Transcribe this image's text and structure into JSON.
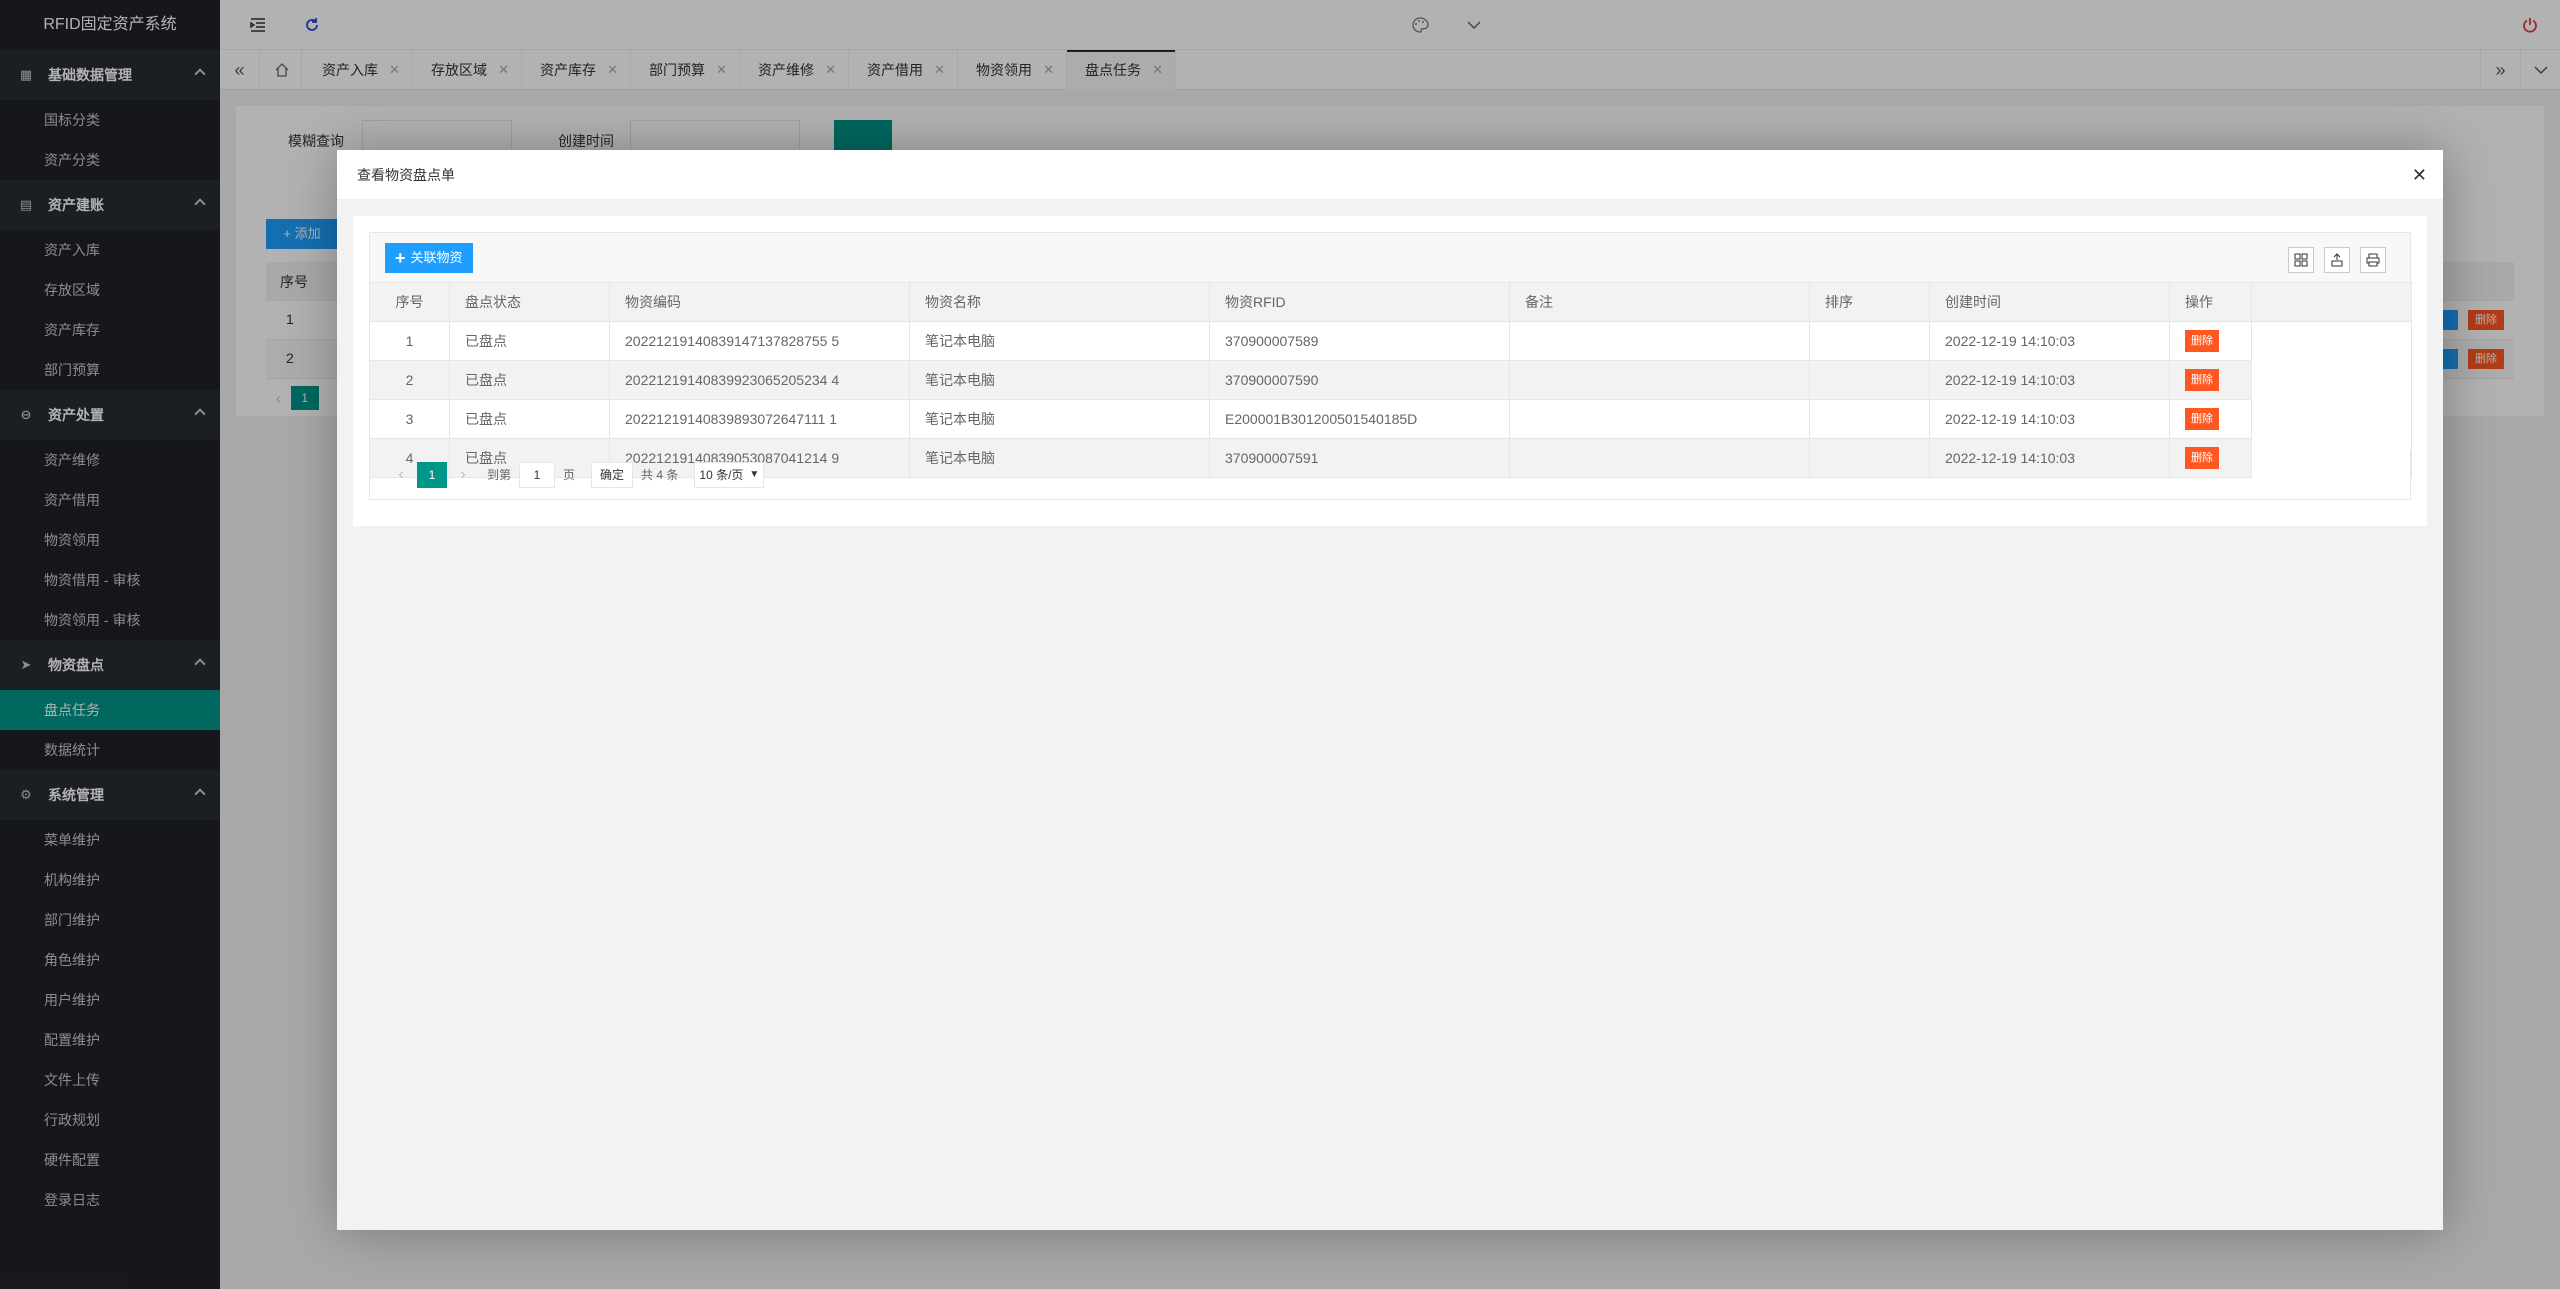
{
  "app": {
    "title": "RFID固定资产系统"
  },
  "sidebar": {
    "groups": [
      {
        "label": "基础数据管理",
        "icon": "database-icon",
        "items": [
          "国标分类",
          "资产分类"
        ]
      },
      {
        "label": "资产建账",
        "icon": "calendar-icon",
        "items": [
          "资产入库",
          "存放区域",
          "资产库存",
          "部门预算"
        ]
      },
      {
        "label": "资产处置",
        "icon": "minus-circle-icon",
        "items": [
          "资产维修",
          "资产借用",
          "物资领用",
          "物资借用 - 审核",
          "物资领用 - 审核"
        ]
      },
      {
        "label": "物资盘点",
        "icon": "send-icon",
        "items": [
          "盘点任务",
          "数据统计"
        ]
      },
      {
        "label": "系统管理",
        "icon": "gear-icon",
        "items": [
          "菜单维护",
          "机构维护",
          "部门维护",
          "角色维护",
          "用户维护",
          "配置维护",
          "文件上传",
          "行政规划",
          "硬件配置",
          "登录日志"
        ]
      }
    ],
    "active_item": "盘点任务"
  },
  "header": {
    "icons": [
      "menu-fold-icon",
      "refresh-icon",
      "palette-icon",
      "chevron-down-icon",
      "power-icon"
    ]
  },
  "tabs": [
    {
      "label": "资产入库"
    },
    {
      "label": "存放区域"
    },
    {
      "label": "资产库存"
    },
    {
      "label": "部门预算"
    },
    {
      "label": "资产维修"
    },
    {
      "label": "资产借用"
    },
    {
      "label": "物资领用"
    },
    {
      "label": "盘点任务",
      "active": true
    }
  ],
  "background_page": {
    "search_label": "模糊查询",
    "created_label": "创建时间",
    "add_label": "添加",
    "col_index": "序号",
    "rows": [
      "1",
      "2"
    ],
    "page": "1",
    "delete_label": "删除"
  },
  "modal": {
    "title": "查看物资盘点单",
    "link_button": "关联物资",
    "columns": [
      "序号",
      "盘点状态",
      "物资编码",
      "物资名称",
      "物资RFID",
      "备注",
      "排序",
      "创建时间",
      "操作"
    ],
    "rows": [
      {
        "index": "1",
        "status": "已盘点",
        "code": "20221219140839147137828755 5",
        "name": "笔记本电脑",
        "rfid": "370900007589",
        "remark": "",
        "sort": "",
        "created": "2022-12-19 14:10:03",
        "action": "删除"
      },
      {
        "index": "2",
        "status": "已盘点",
        "code": "20221219140839923065205234 4",
        "name": "笔记本电脑",
        "rfid": "370900007590",
        "remark": "",
        "sort": "",
        "created": "2022-12-19 14:10:03",
        "action": "删除"
      },
      {
        "index": "3",
        "status": "已盘点",
        "code": "20221219140839893072647111 1",
        "name": "笔记本电脑",
        "rfid": "E200001B301200501540185D",
        "remark": "",
        "sort": "",
        "created": "2022-12-19 14:10:03",
        "action": "删除"
      },
      {
        "index": "4",
        "status": "已盘点",
        "code": "20221219140839053087041214 9",
        "name": "笔记本电脑",
        "rfid": "370900007591",
        "remark": "",
        "sort": "",
        "created": "2022-12-19 14:10:03",
        "action": "删除"
      }
    ],
    "pager": {
      "current": "1",
      "goto_label": "到第",
      "page_value": "1",
      "page_unit": "页",
      "confirm": "确定",
      "total": "共 4 条",
      "page_size": "10 条/页"
    }
  }
}
